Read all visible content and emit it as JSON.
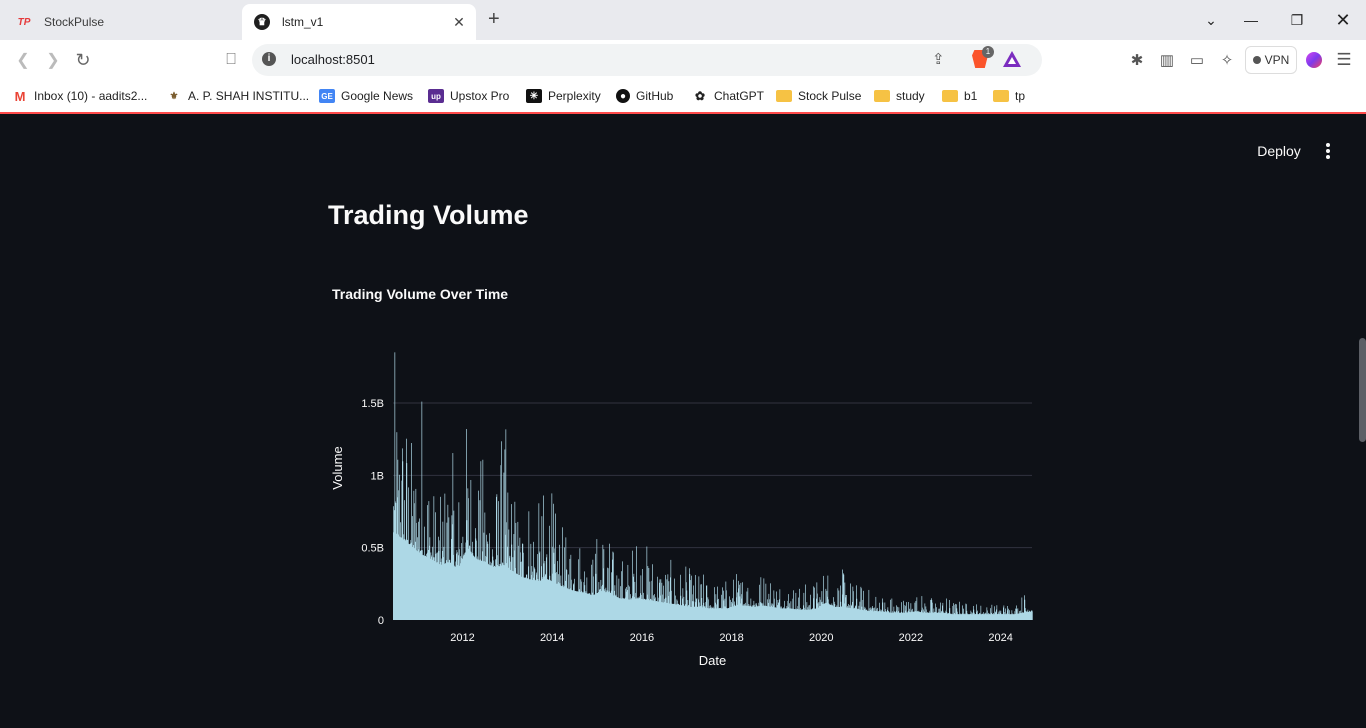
{
  "browser": {
    "tabs": [
      {
        "title": "StockPulse",
        "active": false,
        "icon": "stockpulse-icon"
      },
      {
        "title": "lstm_v1",
        "active": true,
        "icon": "streamlit-icon"
      }
    ],
    "address": "localhost:8501",
    "brave_badge": "1",
    "vpn_label": "VPN",
    "bookmarks": [
      {
        "label": "Inbox (10) - aadits2...",
        "icon": "gmail-icon"
      },
      {
        "label": "A. P. SHAH INSTITU...",
        "icon": "college-icon"
      },
      {
        "label": "Google News",
        "icon": "google-news-icon"
      },
      {
        "label": "Upstox Pro",
        "icon": "upstox-icon"
      },
      {
        "label": "Perplexity",
        "icon": "perplexity-icon"
      },
      {
        "label": "GitHub",
        "icon": "github-icon"
      },
      {
        "label": "ChatGPT",
        "icon": "chatgpt-icon"
      },
      {
        "label": "Stock Pulse",
        "icon": "folder-icon"
      },
      {
        "label": "study",
        "icon": "folder-icon"
      },
      {
        "label": "b1",
        "icon": "folder-icon"
      },
      {
        "label": "tp",
        "icon": "folder-icon"
      }
    ]
  },
  "app": {
    "deploy_label": "Deploy",
    "heading": "Trading Volume"
  },
  "colors": {
    "background": "#0e1117",
    "bars": "#add8e6",
    "accent": "#ff4b4b"
  },
  "chart_data": {
    "type": "bar",
    "title": "Trading Volume Over Time",
    "xlabel": "Date",
    "ylabel": "Volume",
    "x_ticks": [
      "2012",
      "2014",
      "2016",
      "2018",
      "2020",
      "2022",
      "2024"
    ],
    "y_ticks": [
      "0",
      "0.5B",
      "1B",
      "1.5B"
    ],
    "ylim_billions": [
      0,
      1.88
    ],
    "xlim_years": [
      2010.45,
      2024.7
    ],
    "grid": true,
    "legend": false,
    "series_yearly_envelope": {
      "name": "",
      "x": [
        2010.5,
        2010.7,
        2010.9,
        2011.1,
        2011.3,
        2011.5,
        2011.7,
        2011.9,
        2012.1,
        2012.3,
        2012.5,
        2012.7,
        2012.9,
        2013.1,
        2013.3,
        2013.5,
        2013.7,
        2013.9,
        2014.1,
        2014.3,
        2014.5,
        2014.7,
        2014.9,
        2015.1,
        2015.3,
        2015.5,
        2015.7,
        2015.9,
        2016.1,
        2016.3,
        2016.5,
        2016.7,
        2016.9,
        2017.1,
        2017.3,
        2017.5,
        2017.7,
        2017.9,
        2018.1,
        2018.3,
        2018.5,
        2018.7,
        2018.9,
        2019.1,
        2019.3,
        2019.5,
        2019.7,
        2019.9,
        2020.1,
        2020.3,
        2020.5,
        2020.7,
        2020.9,
        2021.1,
        2021.3,
        2021.5,
        2021.7,
        2021.9,
        2022.1,
        2022.3,
        2022.5,
        2022.7,
        2022.9,
        2023.1,
        2023.3,
        2023.5,
        2023.7,
        2023.9,
        2024.1,
        2024.3,
        2024.5,
        2024.7
      ],
      "peak_billions": [
        1.85,
        1.68,
        1.2,
        1.87,
        1.0,
        0.85,
        1.25,
        1.0,
        1.5,
        1.05,
        1.25,
        0.9,
        1.45,
        1.0,
        0.8,
        1.05,
        0.8,
        1.1,
        0.7,
        0.6,
        0.75,
        0.55,
        0.5,
        0.8,
        0.55,
        0.45,
        0.48,
        0.65,
        0.55,
        0.5,
        0.45,
        0.4,
        0.38,
        0.35,
        0.35,
        0.3,
        0.28,
        0.3,
        0.35,
        0.38,
        0.32,
        0.38,
        0.35,
        0.3,
        0.28,
        0.25,
        0.27,
        0.3,
        0.42,
        0.3,
        0.36,
        0.28,
        0.25,
        0.22,
        0.2,
        0.18,
        0.17,
        0.16,
        0.2,
        0.18,
        0.16,
        0.18,
        0.15,
        0.14,
        0.12,
        0.13,
        0.11,
        0.12,
        0.13,
        0.12,
        0.2,
        0.32
      ],
      "base_billions": [
        0.6,
        0.55,
        0.5,
        0.45,
        0.42,
        0.38,
        0.4,
        0.35,
        0.5,
        0.42,
        0.4,
        0.36,
        0.38,
        0.34,
        0.3,
        0.28,
        0.27,
        0.28,
        0.25,
        0.22,
        0.2,
        0.19,
        0.17,
        0.2,
        0.18,
        0.15,
        0.14,
        0.15,
        0.14,
        0.13,
        0.12,
        0.11,
        0.1,
        0.09,
        0.09,
        0.08,
        0.08,
        0.08,
        0.1,
        0.1,
        0.09,
        0.1,
        0.09,
        0.08,
        0.08,
        0.07,
        0.07,
        0.08,
        0.12,
        0.09,
        0.09,
        0.08,
        0.07,
        0.06,
        0.06,
        0.05,
        0.05,
        0.05,
        0.06,
        0.05,
        0.05,
        0.05,
        0.04,
        0.04,
        0.04,
        0.04,
        0.04,
        0.04,
        0.04,
        0.04,
        0.05,
        0.06
      ]
    }
  }
}
